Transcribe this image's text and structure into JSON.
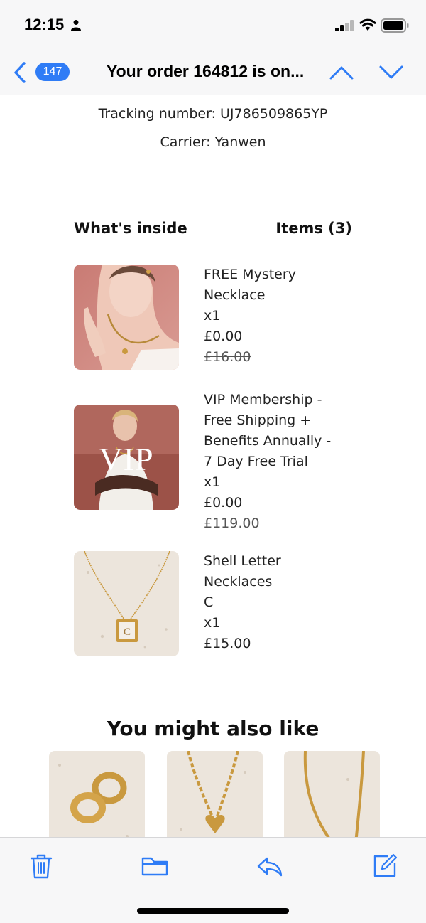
{
  "status": {
    "time": "12:15"
  },
  "nav": {
    "badge_count": "147",
    "title": "Your order 164812 is on..."
  },
  "shipping": {
    "tracking_label": "Tracking number: UJ786509865YP",
    "carrier_label": "Carrier: Yanwen"
  },
  "inside": {
    "title": "What's inside",
    "count_label": "Items (3)"
  },
  "items": [
    {
      "name_line1": "FREE Mystery",
      "name_line2": "Necklace",
      "qty": "x1",
      "price": "£0.00",
      "original_price": "£16.00"
    },
    {
      "name_line1": "VIP Membership -",
      "name_line2": "Free Shipping +",
      "name_line3": "Benefits Annually -",
      "name_line4": "7 Day Free Trial",
      "qty": "x1",
      "price": "£0.00",
      "original_price": "£119.00",
      "image_text": "VIP"
    },
    {
      "name_line1": "Shell Letter",
      "name_line2": "Necklaces",
      "variant": "C",
      "qty": "x1",
      "price": "£15.00",
      "image_letter": "C"
    }
  ],
  "recommendations": {
    "title": "You might also like"
  },
  "icons": {
    "back": "chevron-left-icon",
    "up": "chevron-up-icon",
    "down": "chevron-down-icon",
    "trash": "trash-icon",
    "folder": "folder-icon",
    "reply": "reply-icon",
    "compose": "compose-icon"
  },
  "colors": {
    "accent": "#2f7cf6",
    "bar_background": "#f7f7f8"
  }
}
